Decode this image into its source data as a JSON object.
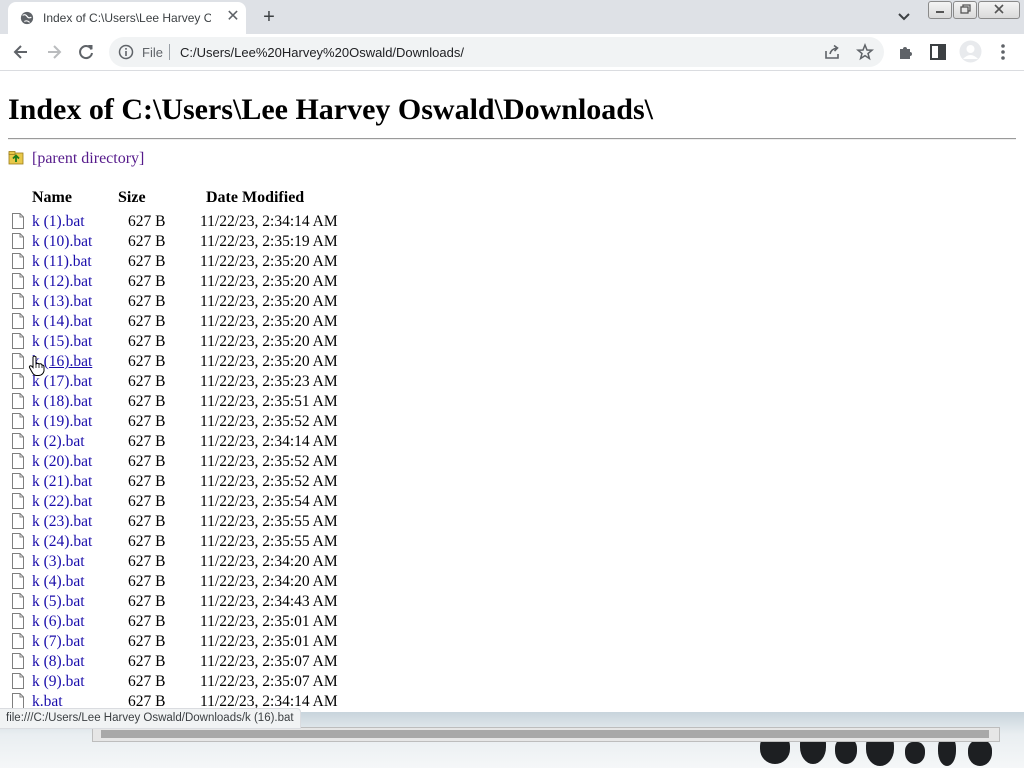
{
  "tab": {
    "title": "Index of C:\\Users\\Lee Harvey Oswald\\Downloads\\"
  },
  "omnibox": {
    "scheme": "File",
    "url": "C:/Users/Lee%20Harvey%20Oswald/Downloads/"
  },
  "page": {
    "heading": "Index of C:\\Users\\Lee Harvey Oswald\\Downloads\\",
    "parent_link": "[parent directory]",
    "columns": {
      "name": "Name",
      "size": "Size",
      "date": "Date Modified"
    },
    "files": [
      {
        "name": "k (1).bat",
        "size": "627 B",
        "date": "11/22/23, 2:34:14 AM"
      },
      {
        "name": "k (10).bat",
        "size": "627 B",
        "date": "11/22/23, 2:35:19 AM"
      },
      {
        "name": "k (11).bat",
        "size": "627 B",
        "date": "11/22/23, 2:35:20 AM"
      },
      {
        "name": "k (12).bat",
        "size": "627 B",
        "date": "11/22/23, 2:35:20 AM"
      },
      {
        "name": "k (13).bat",
        "size": "627 B",
        "date": "11/22/23, 2:35:20 AM"
      },
      {
        "name": "k (14).bat",
        "size": "627 B",
        "date": "11/22/23, 2:35:20 AM"
      },
      {
        "name": "k (15).bat",
        "size": "627 B",
        "date": "11/22/23, 2:35:20 AM"
      },
      {
        "name": "k (16).bat",
        "size": "627 B",
        "date": "11/22/23, 2:35:20 AM"
      },
      {
        "name": "k (17).bat",
        "size": "627 B",
        "date": "11/22/23, 2:35:23 AM"
      },
      {
        "name": "k (18).bat",
        "size": "627 B",
        "date": "11/22/23, 2:35:51 AM"
      },
      {
        "name": "k (19).bat",
        "size": "627 B",
        "date": "11/22/23, 2:35:52 AM"
      },
      {
        "name": "k (2).bat",
        "size": "627 B",
        "date": "11/22/23, 2:34:14 AM"
      },
      {
        "name": "k (20).bat",
        "size": "627 B",
        "date": "11/22/23, 2:35:52 AM"
      },
      {
        "name": "k (21).bat",
        "size": "627 B",
        "date": "11/22/23, 2:35:52 AM"
      },
      {
        "name": "k (22).bat",
        "size": "627 B",
        "date": "11/22/23, 2:35:54 AM"
      },
      {
        "name": "k (23).bat",
        "size": "627 B",
        "date": "11/22/23, 2:35:55 AM"
      },
      {
        "name": "k (24).bat",
        "size": "627 B",
        "date": "11/22/23, 2:35:55 AM"
      },
      {
        "name": "k (3).bat",
        "size": "627 B",
        "date": "11/22/23, 2:34:20 AM"
      },
      {
        "name": "k (4).bat",
        "size": "627 B",
        "date": "11/22/23, 2:34:20 AM"
      },
      {
        "name": "k (5).bat",
        "size": "627 B",
        "date": "11/22/23, 2:34:43 AM"
      },
      {
        "name": "k (6).bat",
        "size": "627 B",
        "date": "11/22/23, 2:35:01 AM"
      },
      {
        "name": "k (7).bat",
        "size": "627 B",
        "date": "11/22/23, 2:35:01 AM"
      },
      {
        "name": "k (8).bat",
        "size": "627 B",
        "date": "11/22/23, 2:35:07 AM"
      },
      {
        "name": "k (9).bat",
        "size": "627 B",
        "date": "11/22/23, 2:35:07 AM"
      },
      {
        "name": "k.bat",
        "size": "627 B",
        "date": "11/22/23, 2:34:14 AM"
      }
    ]
  },
  "status_bar": {
    "url": "file:///C:/Users/Lee Harvey Oswald/Downloads/k (16).bat"
  },
  "icons": {
    "tab_favicon": "globe-icon",
    "tab_close": "close-icon",
    "new_tab": "plus-icon",
    "tab_search": "chevron-down-icon",
    "back": "back-arrow-icon",
    "forward": "forward-arrow-icon",
    "reload": "reload-icon",
    "site_info": "info-icon",
    "share": "share-icon",
    "bookmark": "star-icon",
    "extensions": "puzzle-icon",
    "side_panel": "side-panel-icon",
    "profile": "avatar-icon",
    "menu": "kebab-menu-icon",
    "parent_dir": "folder-up-icon",
    "file": "file-icon",
    "cursor": "hand-cursor-icon"
  },
  "colors": {
    "link": "#1a0dab",
    "visited_link": "#551a8b",
    "tabstrip": "#dee1e6",
    "omnibox": "#f1f3f4"
  },
  "hovered_file": "k (16).bat"
}
